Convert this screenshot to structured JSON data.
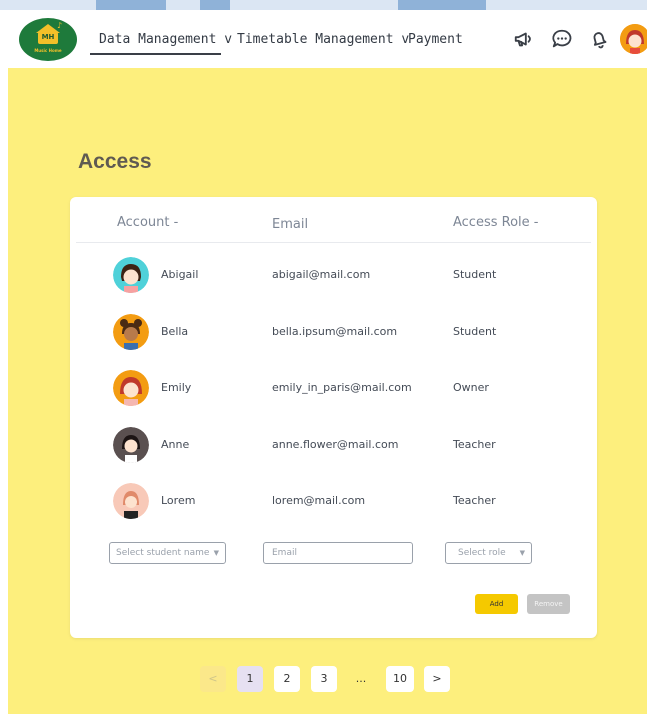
{
  "app": {
    "logo_text": "MH",
    "logo_subtext": "Music Home"
  },
  "nav": {
    "items": [
      {
        "label": "Data Management v",
        "active": true
      },
      {
        "label": "Timetable Management v",
        "active": false
      },
      {
        "label": "Payment",
        "active": false
      }
    ]
  },
  "header_icons": [
    "megaphone-icon",
    "chat-icon",
    "bell-icon",
    "user-avatar"
  ],
  "page": {
    "title": "Access"
  },
  "table": {
    "headers": {
      "account": "Account -",
      "email": "Email",
      "role": "Access Role -"
    },
    "rows": [
      {
        "name": "Abigail",
        "email": "abigail@mail.com",
        "role": "Student",
        "avatar_bg": "#4fd1d9"
      },
      {
        "name": "Bella",
        "email": "bella.ipsum@mail.com",
        "role": "Student",
        "avatar_bg": "#f39c12"
      },
      {
        "name": "Emily",
        "email": "emily_in_paris@mail.com",
        "role": "Owner",
        "avatar_bg": "#f39c12"
      },
      {
        "name": "Anne",
        "email": "anne.flower@mail.com",
        "role": "Teacher",
        "avatar_bg": "#5a5050"
      },
      {
        "name": "Lorem",
        "email": "lorem@mail.com",
        "role": "Teacher",
        "avatar_bg": "#f8c9b8"
      }
    ]
  },
  "form": {
    "student_placeholder": "Select student name",
    "email_placeholder": "Email",
    "role_placeholder": "Select role",
    "add_label": "Add",
    "remove_label": "Remove"
  },
  "pagination": {
    "prev": "<",
    "pages": [
      "1",
      "2",
      "3",
      "...",
      "10"
    ],
    "current": "1",
    "next": ">"
  },
  "colors": {
    "background": "#fdef7d",
    "add_button": "#f5c900",
    "remove_button": "#c4c4c4",
    "logo_green": "#1e7a3b"
  }
}
